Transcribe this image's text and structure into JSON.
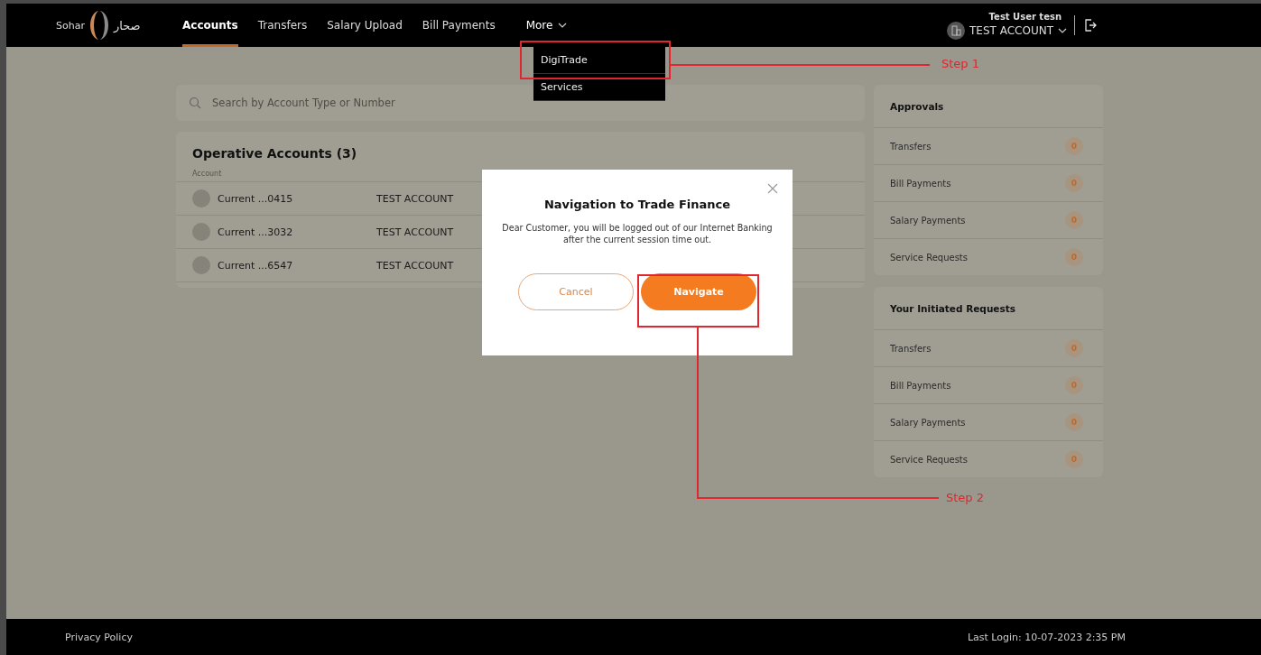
{
  "logo": {
    "text": "Sohar",
    "text_arabic": "صحار"
  },
  "nav": {
    "tabs": [
      {
        "label": "Accounts",
        "selected": true
      },
      {
        "label": "Transfers",
        "selected": false
      },
      {
        "label": "Salary Upload",
        "selected": false
      },
      {
        "label": "Bill Payments",
        "selected": false
      }
    ],
    "more": {
      "label": "More",
      "expanded": true
    }
  },
  "user": {
    "name": "Test User tesn",
    "account": "TEST ACCOUNT"
  },
  "more_menu": [
    {
      "label": "DigiTrade"
    },
    {
      "label": "Services"
    }
  ],
  "search": {
    "placeholder": "Search by Account Type or Number"
  },
  "accounts": {
    "title": "Operative Accounts (3)",
    "column_1": "Account",
    "rows": [
      {
        "name": "Current ...0415",
        "holder": "TEST ACCOUNT"
      },
      {
        "name": "Current ...3032",
        "holder": "TEST ACCOUNT"
      },
      {
        "name": "Current ...6547",
        "holder": "TEST ACCOUNT"
      }
    ]
  },
  "panels": [
    {
      "title": "Approvals",
      "items": [
        {
          "label": "Transfers",
          "count": "0"
        },
        {
          "label": "Bill Payments",
          "count": "0"
        },
        {
          "label": "Salary Payments",
          "count": "0"
        },
        {
          "label": "Service Requests",
          "count": "0"
        }
      ]
    },
    {
      "title": "Your Initiated Requests",
      "items": [
        {
          "label": "Transfers",
          "count": "0"
        },
        {
          "label": "Bill Payments",
          "count": "0"
        },
        {
          "label": "Salary Payments",
          "count": "0"
        },
        {
          "label": "Service Requests",
          "count": "0"
        }
      ]
    }
  ],
  "dialog": {
    "title": "Navigation to Trade Finance",
    "message": "Dear Customer, you will be logged out of our Internet Banking after the current session time out.",
    "buttons": [
      {
        "label": "Cancel",
        "kind": "secondary"
      },
      {
        "label": "Navigate",
        "kind": "primary"
      }
    ]
  },
  "annotations": [
    {
      "label": "Step 1"
    },
    {
      "label": "Step 2"
    }
  ],
  "footer": {
    "link": "Privacy Policy",
    "last_login": "Last Login: 10-07-2023 2:35 PM"
  }
}
